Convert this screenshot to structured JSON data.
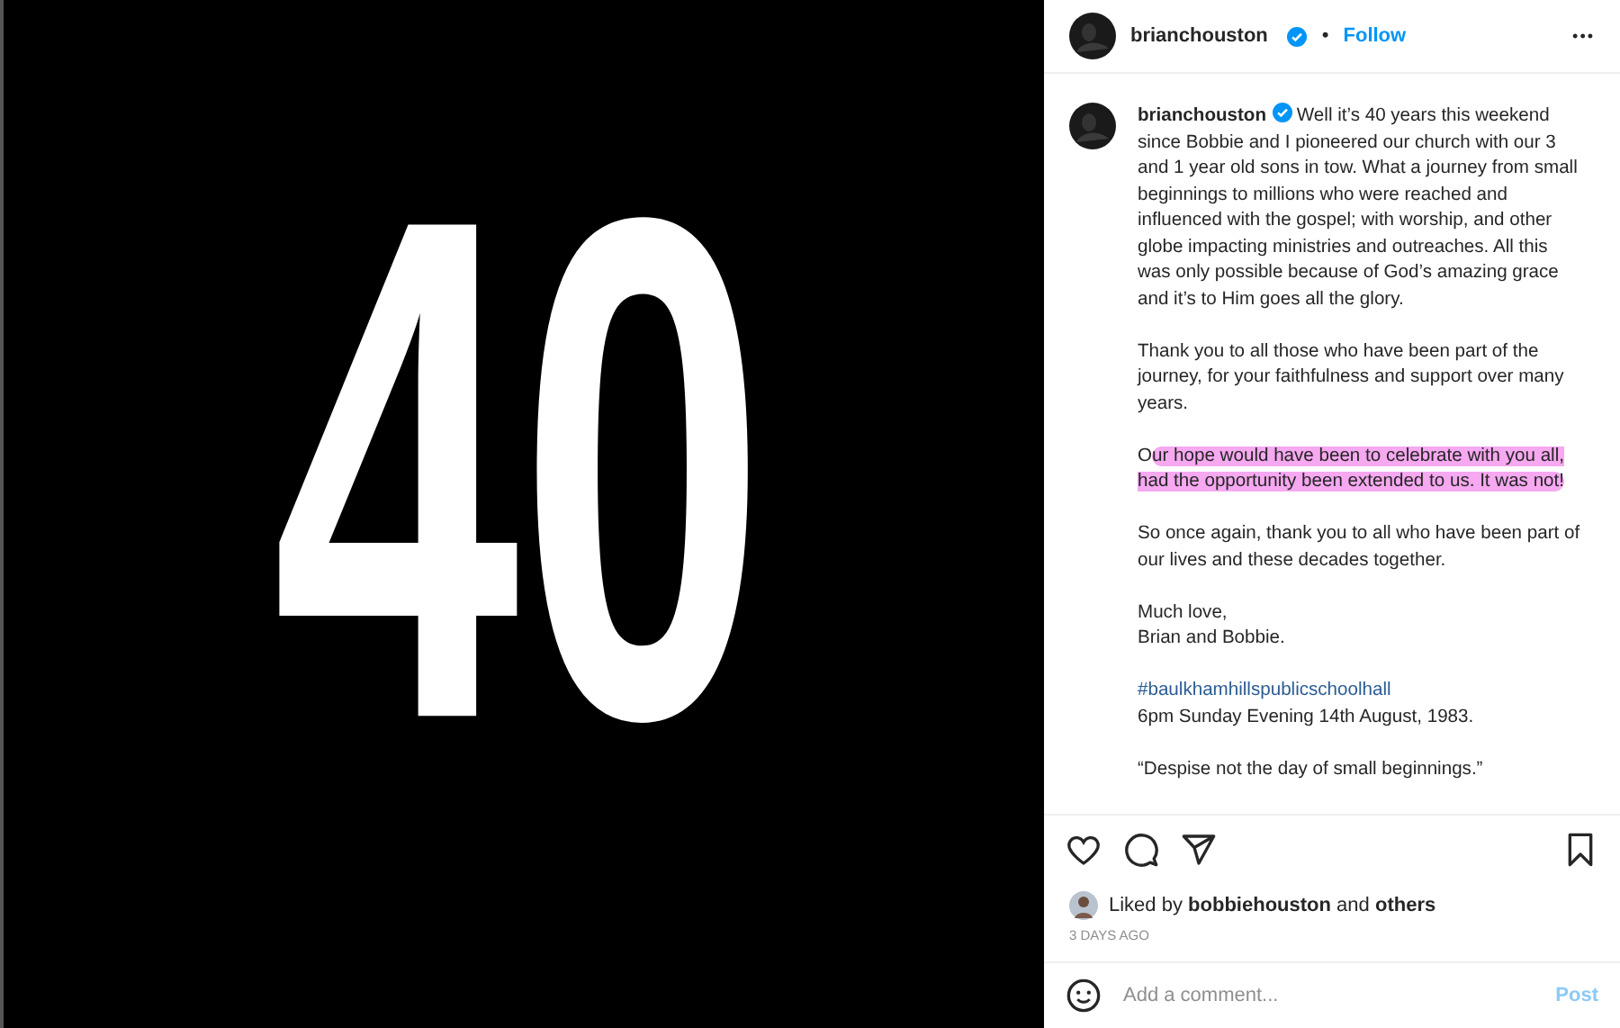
{
  "post_image": {
    "text": "40"
  },
  "header": {
    "username": "brianchouston",
    "verified": true,
    "separator": "•",
    "follow": "Follow",
    "more": "•••"
  },
  "caption": {
    "username": "brianchouston",
    "verified": true,
    "paragraphs": [
      [
        {
          "text": "Well it’s 40 years this weekend since Bobbie and I pioneered our church with our 3 and 1 year old sons in tow. What a journey from small beginnings to millions who were reached and influenced with the gospel; with worship, and other globe impacting ministries and outreaches. All this was only possible because of God’s amazing grace and it’s to Him goes all the glory."
        }
      ],
      [
        {
          "text": "Thank you to all those who have been part of the journey, for your faithfulness and support over many years."
        }
      ],
      [
        {
          "text": "O",
          "highlighted": false
        },
        {
          "text": "ur hope would have been to celebrate with you all, had the opportunity been extended to us. It was not!",
          "highlighted": true
        }
      ],
      [
        {
          "text": "So once again, thank you to all who have been part of our lives and these decades together."
        }
      ],
      [
        {
          "text": "Much love,"
        }
      ],
      [
        {
          "text": "Brian and Bobbie."
        }
      ],
      [
        {
          "text": "#baulkhamhillspublicschoolhall",
          "kind": "hashtag"
        }
      ],
      [
        {
          "text": "6pm Sunday Evening 14th August, 1983."
        }
      ],
      [
        {
          "text": "“Despise not the day of small beginnings.”"
        }
      ]
    ]
  },
  "likes": {
    "prefix": "Liked by",
    "user": "bobbiehouston",
    "middle": "and",
    "others": "others"
  },
  "date": "3 DAYS AGO",
  "comment": {
    "placeholder": "Add a comment...",
    "post": "Post",
    "post_disabled": true
  }
}
